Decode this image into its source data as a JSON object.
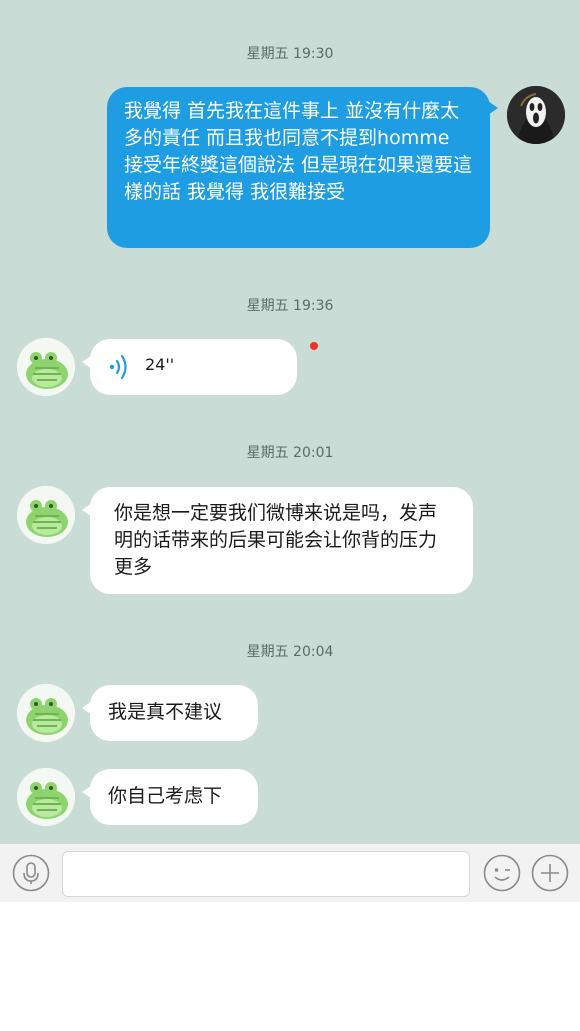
{
  "messages": [
    {
      "timestamp": "星期五 19:30",
      "sender": "me",
      "type": "text",
      "text": "我覺得 首先我在這件事上 並沒有什麼太多的責任 而且我也同意不提到homme 接受年終獎這個說法 但是現在如果還要這樣的話 我覺得 我很難接受"
    },
    {
      "timestamp": "星期五 19:36",
      "sender": "other",
      "type": "voice",
      "duration": "24''",
      "unread": true
    },
    {
      "timestamp": "星期五 20:01",
      "sender": "other",
      "type": "text",
      "text": "你是想一定要我们微博来说是吗，发声明的话带来的后果可能会让你背的压力更多"
    },
    {
      "timestamp": "星期五 20:04",
      "sender": "other",
      "type": "text",
      "text": "我是真不建议"
    },
    {
      "sender": "other",
      "type": "text",
      "text": "你自己考虑下"
    }
  ],
  "input_bar": {
    "voice_icon": "microphone-icon",
    "emoji_icon": "emoji-icon",
    "more_icon": "plus-icon",
    "input_value": "",
    "input_placeholder": ""
  },
  "colors": {
    "chat_background": "#c9dcd5",
    "my_bubble": "#1e9de3",
    "other_bubble": "#ffffff",
    "unread_dot": "#ee3326"
  }
}
